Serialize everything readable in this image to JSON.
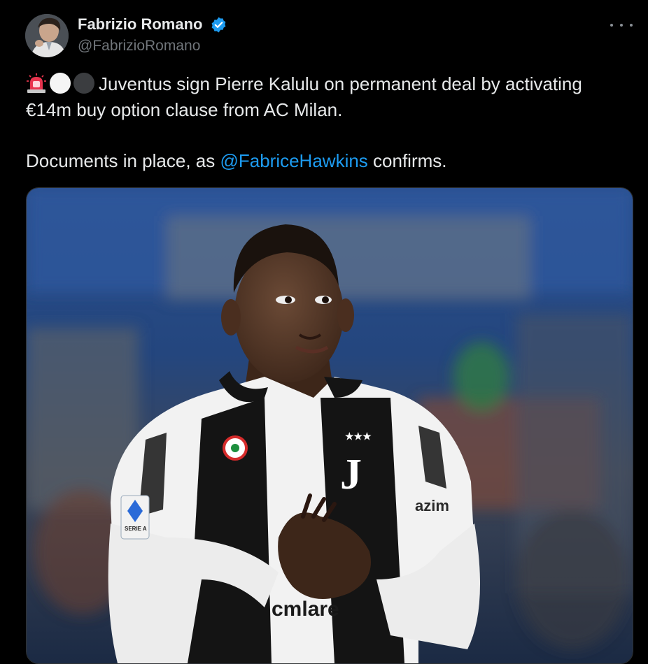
{
  "author": {
    "name": "Fabrizio Romano",
    "handle": "@FabrizioRomano",
    "verified_color": "#1d9bf0"
  },
  "menu": {
    "icon": "more-horizontal-icon"
  },
  "tweet": {
    "emojis": [
      "police-siren-emoji",
      "white-circle-emoji",
      "black-circle-emoji"
    ],
    "line1": "Juventus sign Pierre Kalulu on permanent deal by activating €14m buy option clause from AC Milan.",
    "para2_prefix": "Documents in place, as ",
    "mention": "@FabriceHawkins",
    "para2_suffix": " confirms."
  },
  "media": {
    "jersey_sponsor": "cmlare",
    "sleeve_sponsor": "azim",
    "patch_text": "SERIE A",
    "colors": {
      "stadium": "#2a4e8c",
      "shirt_black": "#141414",
      "shirt_white": "#f2f2f2",
      "mention": "#1d9bf0"
    }
  }
}
